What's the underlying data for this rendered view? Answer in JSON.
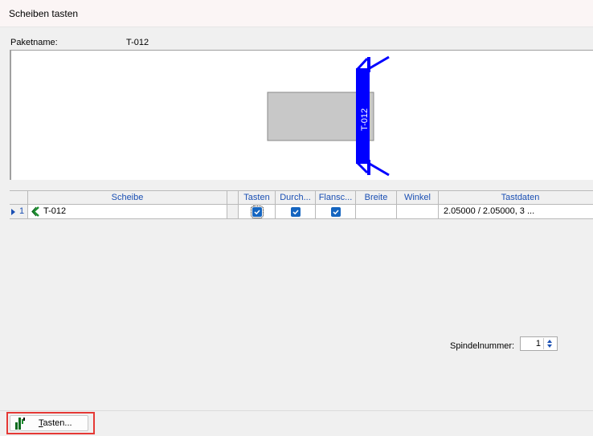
{
  "window": {
    "title": "Scheiben tasten"
  },
  "package": {
    "label": "Paketname:",
    "value": "T-012"
  },
  "preview": {
    "disc_label": "T-012",
    "disc_color": "#0000ff",
    "block_color": "#c8c8c8"
  },
  "grid": {
    "columns": [
      "Scheibe",
      "Tasten",
      "Durch...",
      "Flansc...",
      "Breite",
      "Winkel",
      "Tastdaten"
    ],
    "rows": [
      {
        "number": "1",
        "scheibe": "T-012",
        "tasten": true,
        "durch": true,
        "flansch": true,
        "breite": "",
        "winkel": "",
        "tastdaten": "2.05000 / 2.05000, 3 ..."
      }
    ]
  },
  "spindle": {
    "label": "Spindelnummer:",
    "value": "1"
  },
  "footer": {
    "tasten_button": "Tasten..."
  },
  "colors": {
    "accent": "#1a4fb3",
    "highlight": "#e53935",
    "checkbox": "#1565c0"
  }
}
